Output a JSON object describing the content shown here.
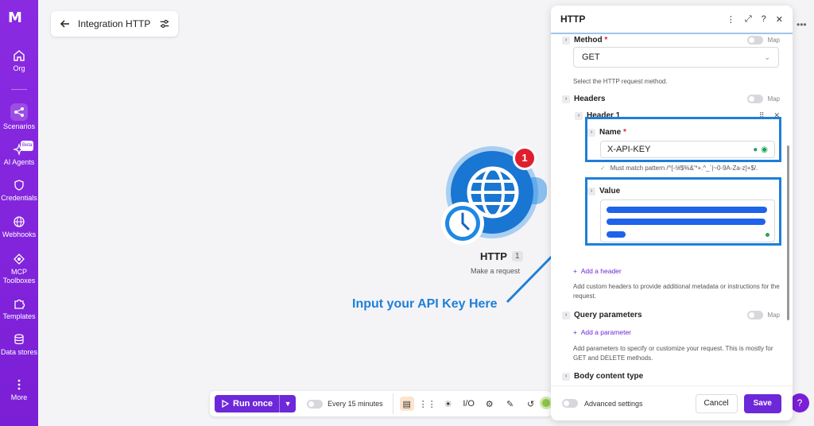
{
  "sidebar": {
    "logo_text": "M",
    "items": [
      {
        "label": "Org",
        "icon": "home-icon"
      },
      {
        "label": "Scenarios",
        "icon": "share-icon"
      },
      {
        "label": "AI Agents",
        "icon": "sparkle-icon",
        "badge": "Beta"
      },
      {
        "label": "Credentials",
        "icon": "shield-icon"
      },
      {
        "label": "Webhooks",
        "icon": "globe-icon"
      },
      {
        "label": "MCP Toolboxes",
        "icon": "mcp-icon"
      },
      {
        "label": "Templates",
        "icon": "puzzle-icon"
      },
      {
        "label": "Data stores",
        "icon": "database-icon"
      },
      {
        "label": "More",
        "icon": "more-vertical-icon"
      }
    ]
  },
  "header": {
    "title": "Integration HTTP"
  },
  "module": {
    "name": "HTTP",
    "count": "1",
    "subtitle": "Make a request",
    "badge": "1"
  },
  "annotation": "Input your API Key Here",
  "toolbar": {
    "run_label": "Run once",
    "schedule_label": "Every 15 minutes",
    "io_label": "I/O"
  },
  "panel": {
    "title": "HTTP",
    "method": {
      "label": "Method",
      "value": "GET",
      "help": "Select the HTTP request method.",
      "map_label": "Map"
    },
    "headers": {
      "label": "Headers",
      "map_label": "Map"
    },
    "header1": {
      "label": "Header 1"
    },
    "name_field": {
      "label": "Name",
      "value": "X-API-KEY",
      "hint": "Must match pattern /^[-!#$%&'*+.^_`|~0-9A-Za-z]+$/."
    },
    "value_field": {
      "label": "Value"
    },
    "add_header": "Add a header",
    "headers_help": "Add custom headers to provide additional metadata or instructions for the request.",
    "query": {
      "label": "Query parameters",
      "map_label": "Map"
    },
    "add_parameter": "Add a parameter",
    "query_help": "Add parameters to specify or customize your request. This is mostly for GET and DELETE methods.",
    "body_label": "Body content type",
    "advanced_label": "Advanced settings",
    "cancel_label": "Cancel",
    "save_label": "Save"
  },
  "colors": {
    "brand": "#7b1fd6",
    "primary": "#6d28d9",
    "annotation": "#1e7fd8",
    "node": "#1976d2",
    "badge": "#e01e2f"
  }
}
